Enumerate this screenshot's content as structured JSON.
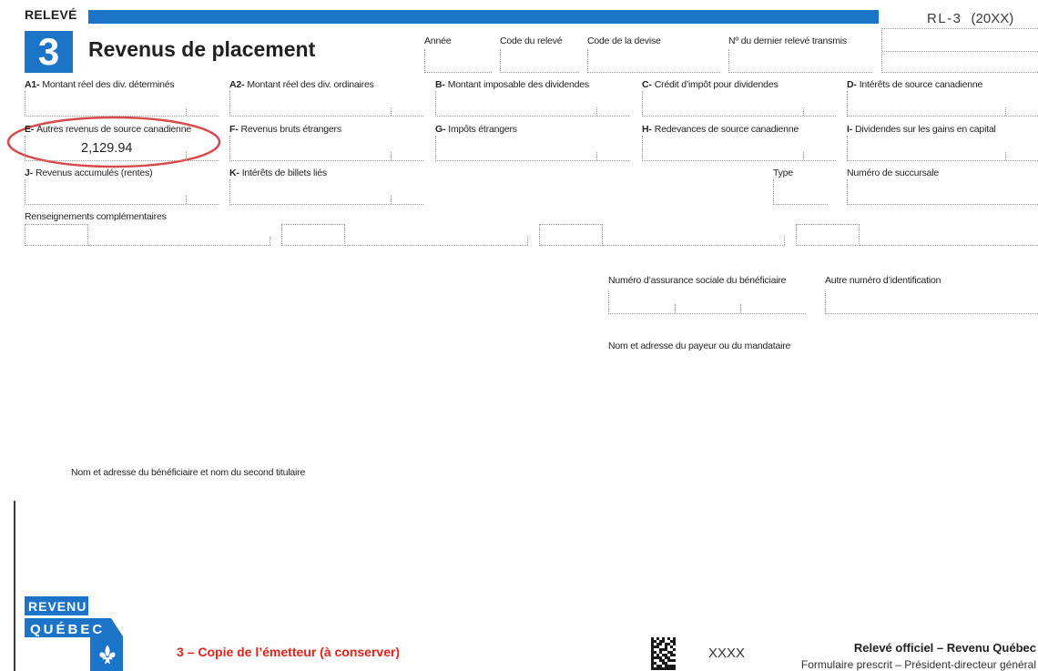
{
  "form": {
    "releve_label": "RELEVÉ",
    "number": "3",
    "title": "Revenus de placement",
    "code": "RL-3",
    "year": "(20XX)"
  },
  "header_fields": {
    "annee": "Année",
    "code_releve": "Code du relevé",
    "code_devise": "Code de la devise",
    "dernier_releve": "Nº du dernier relevé transmis"
  },
  "boxes": {
    "a1": {
      "code": "A1-",
      "label": "Montant réel des div. déterminés"
    },
    "a2": {
      "code": "A2-",
      "label": "Montant réel des div. ordinaires"
    },
    "b": {
      "code": "B-",
      "label": "Montant imposable des dividendes"
    },
    "c": {
      "code": "C-",
      "label": "Crédit d’impôt pour dividendes"
    },
    "d": {
      "code": "D-",
      "label": "Intérêts de source canadienne"
    },
    "e": {
      "code": "E-",
      "label": "Autres revenus de source canadienne",
      "value": "2,129.94"
    },
    "f": {
      "code": "F-",
      "label": "Revenus bruts étrangers"
    },
    "g": {
      "code": "G-",
      "label": "Impôts étrangers"
    },
    "h": {
      "code": "H-",
      "label": "Redevances de source canadienne"
    },
    "i": {
      "code": "I-",
      "label": "Dividendes sur les gains en capital"
    },
    "j": {
      "code": "J-",
      "label": "Revenus accumulés (rentes)"
    },
    "k": {
      "code": "K-",
      "label": "Intérêts de billets liés"
    }
  },
  "type_label": "Type",
  "succursale_label": "Numéro de succursale",
  "complementary_label": "Renseignements complémentaires",
  "sin_label": "Numéro d’assurance sociale du bénéficiaire",
  "other_id_label": "Autre numéro d’identification",
  "payer_label": "Nom et adresse du payeur ou du mandataire",
  "beneficiary_label": "Nom et adresse du bénéficiaire et nom du second titulaire",
  "footer": {
    "logo_line1": "REVENU",
    "logo_line2": "QUÉBEC",
    "copy_label": "3 – Copie de l’émetteur (à conserver)",
    "barcode_text": "XXXX",
    "official_label": "Relevé officiel – Revenu Québec",
    "prescribed_label": "Formulaire prescrit – Président-directeur général"
  },
  "icons": {
    "logo_symbol": "fleur-de-lis-icon",
    "barcode": "datamatrix-icon"
  },
  "colors": {
    "brand_blue": "#1b74c8",
    "highlight_red": "#d64a4a",
    "copy_label_red": "#e2231a"
  }
}
